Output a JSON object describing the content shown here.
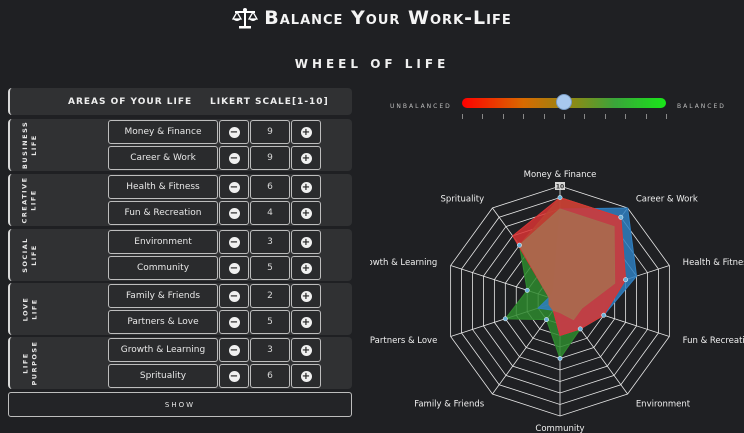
{
  "header": {
    "title": "Balance Your Work-Life",
    "icon": "scale-icon"
  },
  "heading": "WHEEL OF LIFE",
  "table": {
    "col_areas": "AREAS OF YOUR LIFE",
    "col_likert": "LIKERT SCALE[1-10]",
    "groups": [
      {
        "label": "BUSINESS\nLIFE",
        "rows": [
          {
            "name": "Money & Finance",
            "value": "9"
          },
          {
            "name": "Career & Work",
            "value": "9"
          }
        ]
      },
      {
        "label": "CREATIVE\nLIFE",
        "rows": [
          {
            "name": "Health & Fitness",
            "value": "6"
          },
          {
            "name": "Fun & Recreation",
            "value": "4"
          }
        ]
      },
      {
        "label": "SOCIAL\nLIFE",
        "rows": [
          {
            "name": "Environment",
            "value": "3"
          },
          {
            "name": "Community",
            "value": "5"
          }
        ]
      },
      {
        "label": "LOVE\nLIFE",
        "rows": [
          {
            "name": "Family & Friends",
            "value": "2"
          },
          {
            "name": "Partners & Love",
            "value": "5"
          }
        ]
      },
      {
        "label": "LIFE\nPURPOSE",
        "rows": [
          {
            "name": "Growth & Learning",
            "value": "3"
          },
          {
            "name": "Sprituality",
            "value": "6"
          }
        ]
      }
    ],
    "minus_icon": "minus-circle-icon",
    "plus_icon": "plus-circle-icon"
  },
  "show_button": "SHOW",
  "balance": {
    "left_label": "UNBALANCED",
    "right_label": "BALANCED",
    "level": 0.5
  },
  "radar": {
    "axes": [
      "Money & Finance",
      "Career & Work",
      "Health & Fitness",
      "Fun & Recreation",
      "Environment",
      "Community",
      "Family & Friends",
      "Partners & Love",
      "Growth & Learning",
      "Sprituality"
    ],
    "max": 10,
    "center_badge": "10",
    "series": [
      {
        "color": "#2e8a2e",
        "values": [
          9,
          9,
          6,
          4,
          3,
          5,
          2,
          5,
          3,
          6
        ]
      },
      {
        "color": "#2f7fc0",
        "values": [
          8,
          10,
          7,
          4,
          3,
          3,
          1,
          2,
          1,
          1
        ]
      },
      {
        "color": "#d83434",
        "values": [
          9,
          9,
          6,
          4,
          3,
          3,
          1,
          1,
          1,
          7
        ]
      },
      {
        "color": "#a86a4e",
        "values": [
          8,
          8,
          5,
          2,
          2,
          1,
          1,
          1,
          1,
          6
        ]
      }
    ],
    "accent_colors": {
      "grid": "#e8e8e8",
      "points": "#6ab0d8"
    }
  }
}
